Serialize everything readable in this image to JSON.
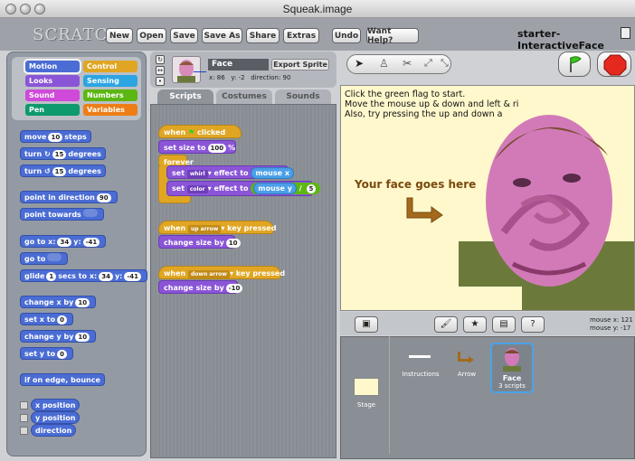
{
  "window": {
    "title": "Squeak.image"
  },
  "app": {
    "logo": "SCRATCH",
    "project_name": "starter-InteractiveFace",
    "menu": [
      "New",
      "Open",
      "Save",
      "Save As",
      "Share",
      "Extras",
      "Undo",
      "Want Help?"
    ]
  },
  "categories": {
    "left": [
      "Motion",
      "Looks",
      "Sound",
      "Pen"
    ],
    "right": [
      "Control",
      "Sensing",
      "Numbers",
      "Variables"
    ],
    "selected": "Motion"
  },
  "motion_blocks": {
    "move_pre": "move",
    "move_val": "10",
    "move_post": "steps",
    "turn_right_pre": "turn",
    "turn_right_val": "15",
    "turn_right_post": "degrees",
    "turn_left_pre": "turn",
    "turn_left_val": "15",
    "turn_left_post": "degrees",
    "point_dir_pre": "point in direction",
    "point_dir_val": "90",
    "point_towards": "point towards",
    "goto_xy_pre": "go to x:",
    "goto_x": "34",
    "goto_y_label": "y:",
    "goto_y": "-41",
    "goto": "go to",
    "glide_pre": "glide",
    "glide_secs": "1",
    "glide_mid": "secs to x:",
    "glide_x": "34",
    "glide_y_label": "y:",
    "glide_y": "-41",
    "change_x_pre": "change x by",
    "change_x_val": "10",
    "set_x_pre": "set x to",
    "set_x_val": "0",
    "change_y_pre": "change y by",
    "change_y_val": "10",
    "set_y_pre": "set y to",
    "set_y_val": "0",
    "bounce": "if on edge, bounce",
    "x_position": "x position",
    "y_position": "y position",
    "direction": "direction"
  },
  "sprite": {
    "name": "Face",
    "export": "Export Sprite",
    "x_label": "x:",
    "x": "86",
    "y_label": "y:",
    "y": "-2",
    "direction_label": "direction:",
    "direction": "90"
  },
  "tabs": [
    "Scripts",
    "Costumes",
    "Sounds"
  ],
  "scripts": {
    "when": "when",
    "clicked": "clicked",
    "set_size_pre": "set size to",
    "set_size_val": "100",
    "set_size_post": "%",
    "forever": "forever",
    "set1_pre": "set",
    "set1_effect": "whirl",
    "set1_mid": "effect to",
    "set1_reporter": "mouse x",
    "set2_pre": "set",
    "set2_effect": "color",
    "set2_mid": "effect to",
    "set2_reporter": "mouse y",
    "set2_op": "/",
    "set2_val": "5",
    "when_key1_pre": "when",
    "when_key1_key": "up arrow",
    "when_key1_post": "key pressed",
    "change_size1_pre": "change size by",
    "change_size1_val": "10",
    "when_key2_pre": "when",
    "when_key2_key": "down arrow",
    "when_key2_post": "key pressed",
    "change_size2_pre": "change size by",
    "change_size2_val": "-10"
  },
  "stage": {
    "line1": "Click the green flag to start.",
    "line2": "Move the mouse up & down and left & ri",
    "line3": "Also, try pressing the up and down a",
    "your_face": "Your face goes here"
  },
  "mouse": {
    "x_label": "mouse x:",
    "x": "121",
    "y_label": "mouse y:",
    "y": "-17"
  },
  "corral": {
    "stage_label": "Stage",
    "sprites": [
      {
        "name": "Instructions"
      },
      {
        "name": "Arrow"
      },
      {
        "name": "Face",
        "scripts": "3 scripts"
      }
    ]
  },
  "colors": {
    "motion": "#4a6cd4",
    "looks": "#8a55d7",
    "sound": "#cf4ad9",
    "pen": "#0e9a6c",
    "control": "#e0a623",
    "sensing": "#2ca5e2",
    "numbers": "#5cb712",
    "variables": "#ee7d16"
  }
}
